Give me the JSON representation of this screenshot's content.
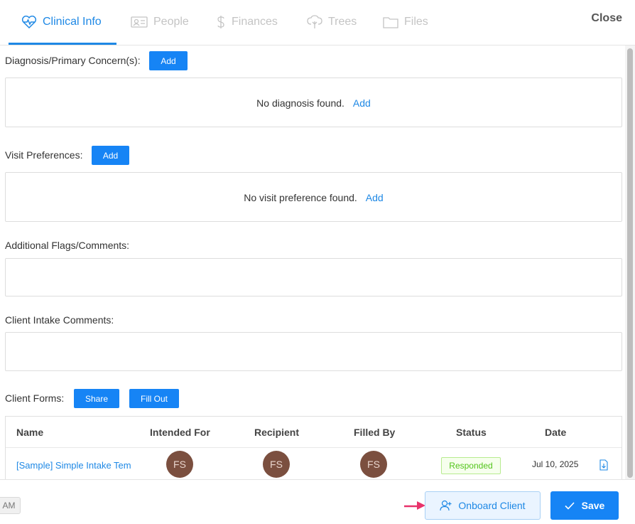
{
  "tabs": [
    {
      "label": "Clinical Info",
      "icon": "heartbeat-icon",
      "active": true
    },
    {
      "label": "People",
      "icon": "id-card-icon",
      "active": false
    },
    {
      "label": "Finances",
      "icon": "dollar-icon",
      "active": false
    },
    {
      "label": "Trees",
      "icon": "tree-icon",
      "active": false
    },
    {
      "label": "Files",
      "icon": "folder-icon",
      "active": false
    }
  ],
  "close_label": "Close",
  "diagnosis": {
    "label": "Diagnosis/Primary Concern(s):",
    "add_label": "Add",
    "empty_text": "No diagnosis found.",
    "empty_link": "Add"
  },
  "visit_prefs": {
    "label": "Visit Preferences:",
    "add_label": "Add",
    "empty_text": "No visit preference found.",
    "empty_link": "Add"
  },
  "flags": {
    "label": "Additional Flags/Comments:"
  },
  "intake": {
    "label": "Client Intake Comments:"
  },
  "forms": {
    "label": "Client Forms:",
    "share_label": "Share",
    "fill_label": "Fill Out",
    "columns": [
      "Name",
      "Intended For",
      "Recipient",
      "Filled By",
      "Status",
      "Date"
    ],
    "rows": [
      {
        "name": "[Sample] Simple Intake Template",
        "intended_for": "FS",
        "recipient": "FS",
        "filled_by": "FS",
        "status": "Responded",
        "date": "Jul 10, 2025"
      }
    ]
  },
  "footer": {
    "am_chip": "AM",
    "onboard_label": "Onboard Client",
    "save_label": "Save"
  },
  "colors": {
    "accent": "#1684f5",
    "avatar": "#7b4f3f",
    "status_green": "#52c41a",
    "arrow": "#e8336b"
  }
}
